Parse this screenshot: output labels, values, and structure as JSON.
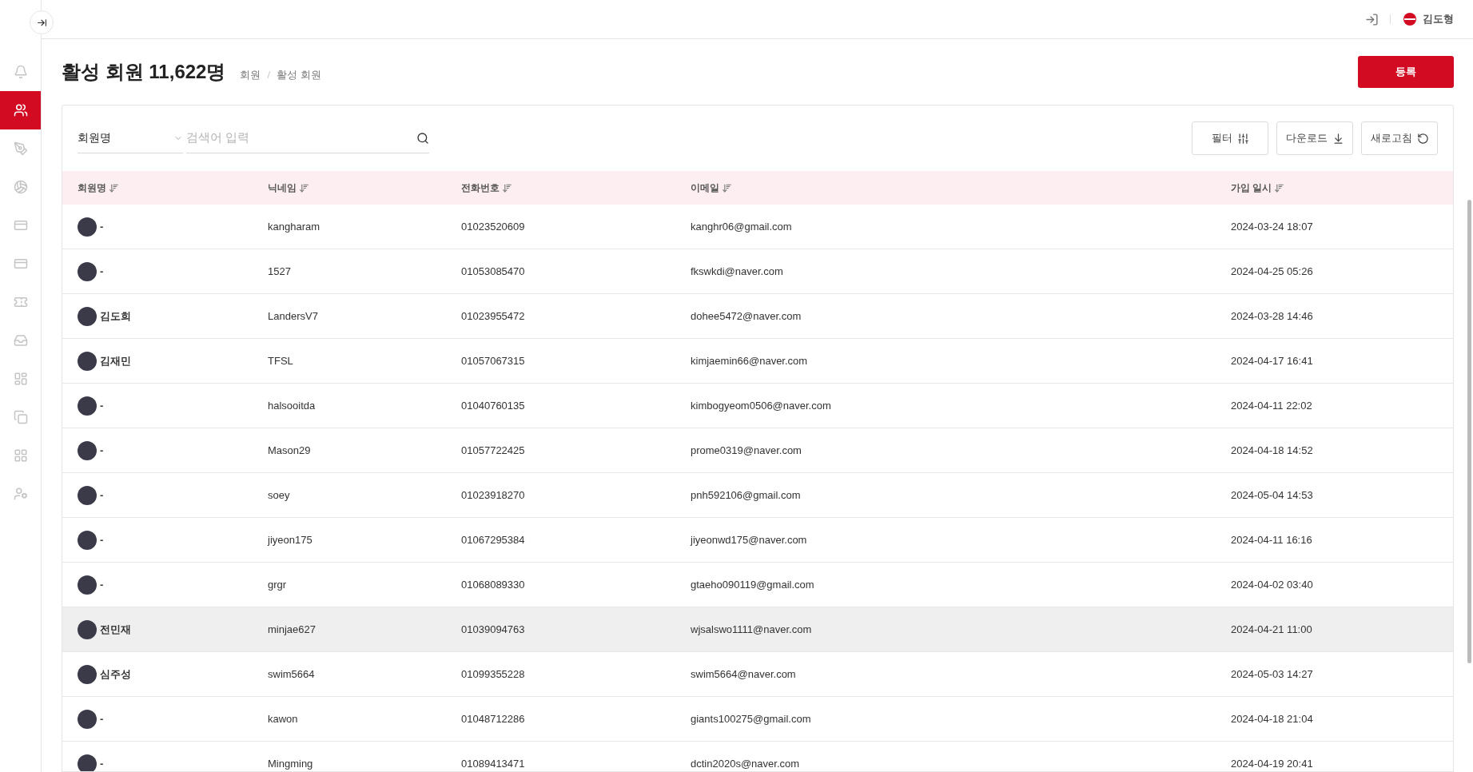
{
  "sidebar": {
    "items": [
      {
        "selected": false
      },
      {
        "selected": true
      },
      {
        "selected": false
      },
      {
        "selected": false
      },
      {
        "selected": false
      },
      {
        "selected": false
      },
      {
        "selected": false
      },
      {
        "selected": false
      },
      {
        "selected": false
      },
      {
        "selected": false
      },
      {
        "selected": false
      },
      {
        "selected": false
      }
    ]
  },
  "header": {
    "user_name": "김도형"
  },
  "page": {
    "title": "활성 회원 11,622명",
    "breadcrumb": [
      "회원",
      "활성 회원"
    ],
    "breadcrumb_separator": "/",
    "register_button": "등록"
  },
  "search": {
    "field_select": "회원명",
    "placeholder": "검색어 입력"
  },
  "toolbar": {
    "filter": "필터",
    "download": "다운로드",
    "refresh": "새로고침"
  },
  "table": {
    "columns": [
      "회원명",
      "닉네임",
      "전화번호",
      "이메일",
      "가입 일시"
    ],
    "rows": [
      {
        "name": "-",
        "nickname": "kangharam",
        "phone": "01023520609",
        "email": "kanghr06@gmail.com",
        "joined": "2024-03-24 18:07",
        "highlighted": false
      },
      {
        "name": "-",
        "nickname": "1527",
        "phone": "01053085470",
        "email": "fkswkdi@naver.com",
        "joined": "2024-04-25 05:26",
        "highlighted": false
      },
      {
        "name": "김도희",
        "nickname": "LandersV7",
        "phone": "01023955472",
        "email": "dohee5472@naver.com",
        "joined": "2024-03-28 14:46",
        "highlighted": false
      },
      {
        "name": "김재민",
        "nickname": "TFSL",
        "phone": "01057067315",
        "email": "kimjaemin66@naver.com",
        "joined": "2024-04-17 16:41",
        "highlighted": false
      },
      {
        "name": "-",
        "nickname": "halsooitda",
        "phone": "01040760135",
        "email": "kimbogyeom0506@naver.com",
        "joined": "2024-04-11 22:02",
        "highlighted": false
      },
      {
        "name": "-",
        "nickname": "Mason29",
        "phone": "01057722425",
        "email": "prome0319@naver.com",
        "joined": "2024-04-18 14:52",
        "highlighted": false
      },
      {
        "name": "-",
        "nickname": "soey",
        "phone": "01023918270",
        "email": "pnh592106@gmail.com",
        "joined": "2024-05-04 14:53",
        "highlighted": false
      },
      {
        "name": "-",
        "nickname": "jiyeon175",
        "phone": "01067295384",
        "email": "jiyeonwd175@naver.com",
        "joined": "2024-04-11 16:16",
        "highlighted": false
      },
      {
        "name": "-",
        "nickname": "grgr",
        "phone": "01068089330",
        "email": "gtaeho090119@gmail.com",
        "joined": "2024-04-02 03:40",
        "highlighted": false
      },
      {
        "name": "전민재",
        "nickname": "minjae627",
        "phone": "01039094763",
        "email": "wjsalswo1111@naver.com",
        "joined": "2024-04-21 11:00",
        "highlighted": true
      },
      {
        "name": "심주성",
        "nickname": "swim5664",
        "phone": "01099355228",
        "email": "swim5664@naver.com",
        "joined": "2024-05-03 14:27",
        "highlighted": false
      },
      {
        "name": "-",
        "nickname": "kawon",
        "phone": "01048712286",
        "email": "giants100275@gmail.com",
        "joined": "2024-04-18 21:04",
        "highlighted": false
      },
      {
        "name": "-",
        "nickname": "Mingming",
        "phone": "01089413471",
        "email": "dctin2020s@naver.com",
        "joined": "2024-04-19 20:41",
        "highlighted": false
      }
    ]
  }
}
